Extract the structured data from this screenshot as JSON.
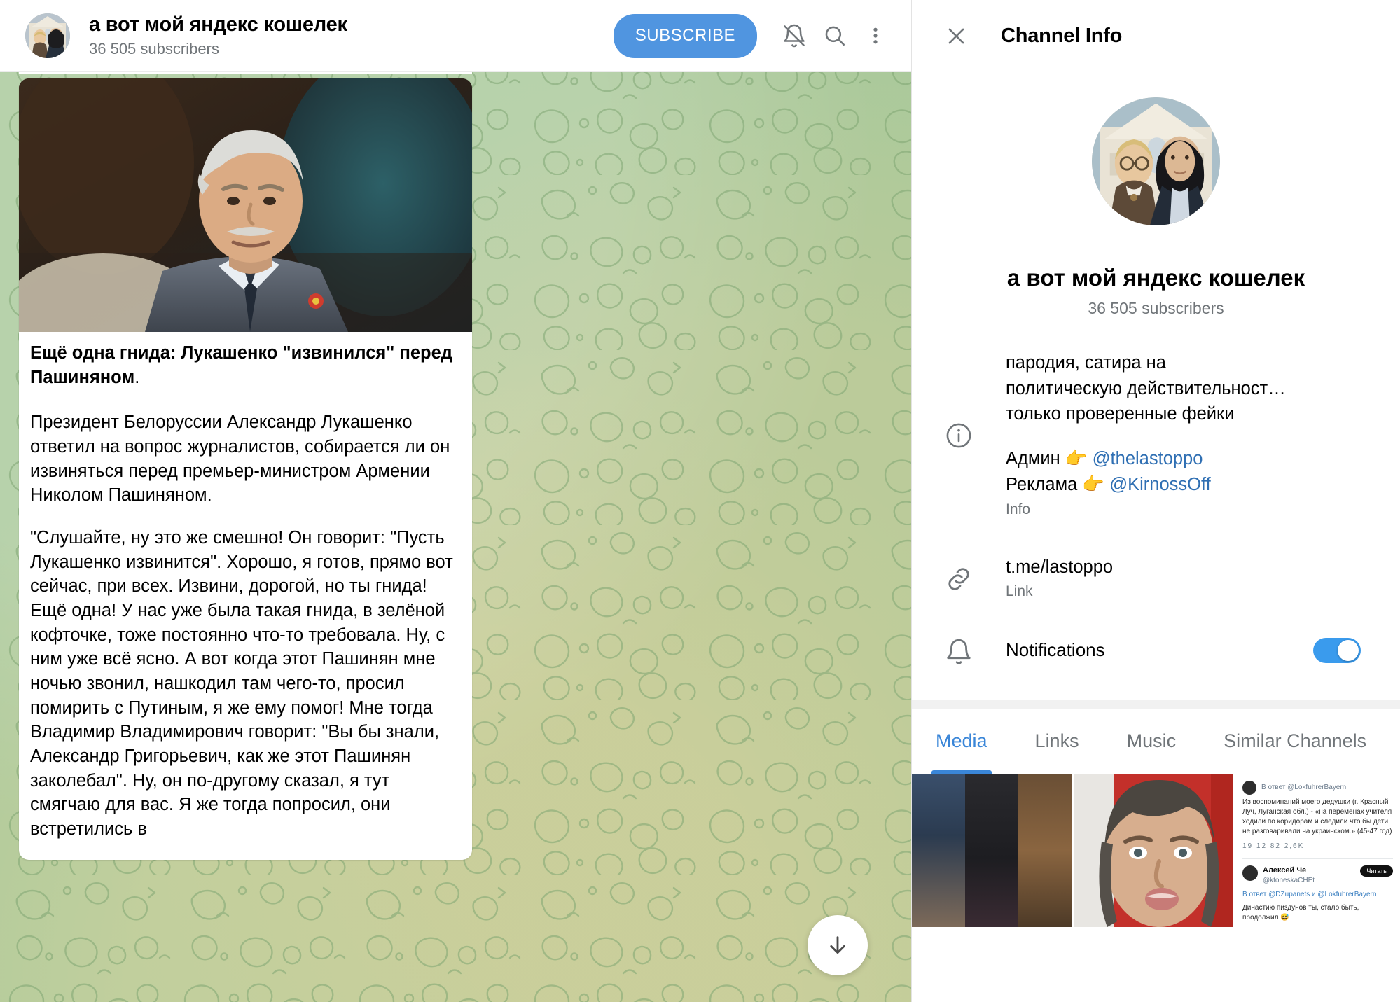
{
  "chat_header": {
    "title": "а вот мой яндекс кошелек",
    "subscribers": "36 505 subscribers",
    "subscribe_label": "SUBSCRIBE",
    "icons": {
      "mute": "bell-muted-icon",
      "search": "search-icon",
      "more": "more-vertical-icon"
    }
  },
  "message": {
    "headline_bold": "Ещё одна гнида: Лукашенко \"извинился\" перед Пашиняном",
    "headline_tail": ".",
    "paragraph_2": "Президент Белоруссии Александр Лукашенко ответил на вопрос журналистов, собирается ли он извиняться перед премьер-министром Армении Николом Пашиняном.",
    "paragraph_3": "\"Слушайте, ну это же смешно! Он говорит: \"Пусть Лукашенко извинится\". Хорошо, я готов, прямо вот сейчас, при всех. Извини, дорогой, но ты гнида! Ещё одна! У нас уже была такая гнида, в зелёной кофточке, тоже постоянно что-то требовала. Ну, с ним уже всё ясно. А вот когда этот Пашинян мне ночью звонил, нашкодил там чего-то, просил помирить с Путиным, я же ему помог! Мне тогда Владимир Владимирович говорит: \"Вы бы знали, Александр Григорьевич, как же этот Пашинян заколебал\". Ну, он по-другому сказал, я тут смягчаю для вас. Я же тогда попросил, они встретились в"
  },
  "scroll_button": {
    "icon": "arrow-down-icon"
  },
  "panel": {
    "title": "Channel Info",
    "close_icon": "close-icon",
    "profile": {
      "name": "а вот мой яндекс кошелек",
      "subscribers": "36 505 subscribers",
      "avatar": "channel-avatar"
    },
    "info_row": {
      "icon": "info-circle-icon",
      "description_line1": "пародия, сатира на",
      "description_line2": "политическую действительност…",
      "description_line3": "только проверенные фейки",
      "admin_label": "Админ 👉 ",
      "admin_handle": "@thelastoppo",
      "ads_label": "Реклама 👉 ",
      "ads_handle": "@KirnossOff",
      "label": "Info"
    },
    "link_row": {
      "icon": "link-icon",
      "value": "t.me/lastoppo",
      "label": "Link"
    },
    "notifications_row": {
      "icon": "bell-icon",
      "label": "Notifications",
      "enabled": true,
      "accent": "#3a9bed"
    },
    "tabs": [
      {
        "label": "Media",
        "active": true
      },
      {
        "label": "Links",
        "active": false
      },
      {
        "label": "Music",
        "active": false
      },
      {
        "label": "Similar Channels",
        "active": false
      }
    ],
    "media_thumbs": [
      {
        "name": "thumb-three-women"
      },
      {
        "name": "thumb-baerbock-portrait"
      },
      {
        "name": "thumb-tweet-screenshot"
      }
    ],
    "tweet_thumb": {
      "reply_to": "В ответ @LokfuhrerBayern",
      "body": "Из воспоминаний моего дедушки (г. Красный Луч, Луганская обл.) - «на переменах учителя ходили по коридорам и следили что бы дети не разговаривали на украинском.» (45-47 год)",
      "stats": "19   12   82   2,6K",
      "author_name": "Алексей Че",
      "author_handle": "@ktoneskaCHEt",
      "read_button": "Читать",
      "reply_line": "В ответ @DZupanets и @LokfuhrerBayern",
      "last_line": "Династию пиздунов ты, стало быть, продолжил 😅"
    }
  },
  "colors": {
    "accent_blue": "#5095e0",
    "tab_blue": "#3a86d8",
    "link_blue": "#2f6fb3",
    "chat_bg_green": "#a9c99b",
    "muted_text": "#707579"
  }
}
